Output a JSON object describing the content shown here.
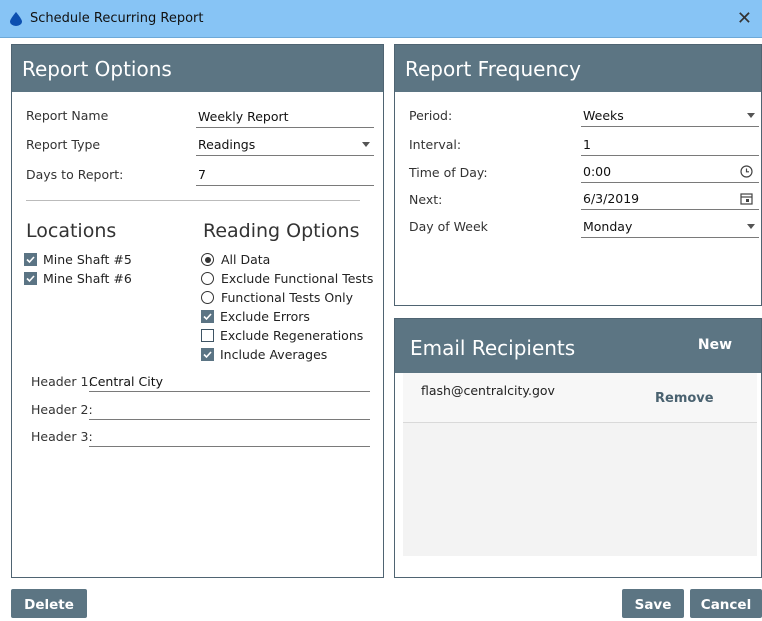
{
  "window": {
    "title": "Schedule Recurring Report",
    "close_glyph": "✕"
  },
  "report_options": {
    "header": "Report Options",
    "name_label": "Report Name",
    "name_value": "Weekly Report",
    "type_label": "Report Type",
    "type_value": "Readings",
    "days_label": "Days to Report:",
    "days_value": "7"
  },
  "locations": {
    "title": "Locations",
    "items": [
      {
        "label": "Mine Shaft #5",
        "checked": true
      },
      {
        "label": "Mine Shaft #6",
        "checked": true
      }
    ]
  },
  "reading_options": {
    "title": "Reading Options",
    "radios": [
      {
        "label": "All Data",
        "selected": true
      },
      {
        "label": "Exclude Functional Tests",
        "selected": false
      },
      {
        "label": "Functional Tests Only",
        "selected": false
      }
    ],
    "checks": [
      {
        "label": "Exclude Errors",
        "checked": true
      },
      {
        "label": "Exclude Regenerations",
        "checked": false
      },
      {
        "label": "Include Averages",
        "checked": true
      }
    ]
  },
  "headers": {
    "h1_label": "Header 1:",
    "h1_value": "Central City",
    "h2_label": "Header 2:",
    "h2_value": "",
    "h3_label": "Header 3:",
    "h3_value": ""
  },
  "frequency": {
    "header": "Report Frequency",
    "period_label": "Period:",
    "period_value": "Weeks",
    "interval_label": "Interval:",
    "interval_value": "1",
    "time_label": "Time of Day:",
    "time_value": "0:00",
    "next_label": "Next:",
    "next_value": "6/3/2019",
    "dow_label": "Day of Week",
    "dow_value": "Monday"
  },
  "email": {
    "header": "Email Recipients",
    "new_label": "New",
    "recipients": [
      {
        "address": "flash@centralcity.gov",
        "remove_label": "Remove"
      }
    ]
  },
  "footer": {
    "delete_label": "Delete",
    "save_label": "Save",
    "cancel_label": "Cancel"
  },
  "colors": {
    "accent": "#5c7583",
    "titlebar": "#87c4f5"
  }
}
